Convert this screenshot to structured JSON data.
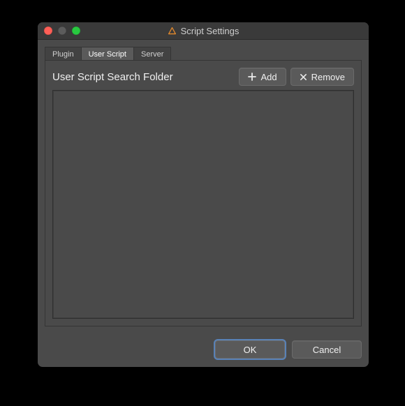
{
  "window": {
    "title": "Script Settings"
  },
  "tabs": [
    {
      "label": "Plugin"
    },
    {
      "label": "User Script"
    },
    {
      "label": "Server"
    }
  ],
  "active_tab_index": 1,
  "section": {
    "label": "User Script Search Folder"
  },
  "buttons": {
    "add": "Add",
    "remove": "Remove",
    "ok": "OK",
    "cancel": "Cancel"
  },
  "list": {
    "items": []
  },
  "colors": {
    "accent_ring": "#5f96dc"
  }
}
